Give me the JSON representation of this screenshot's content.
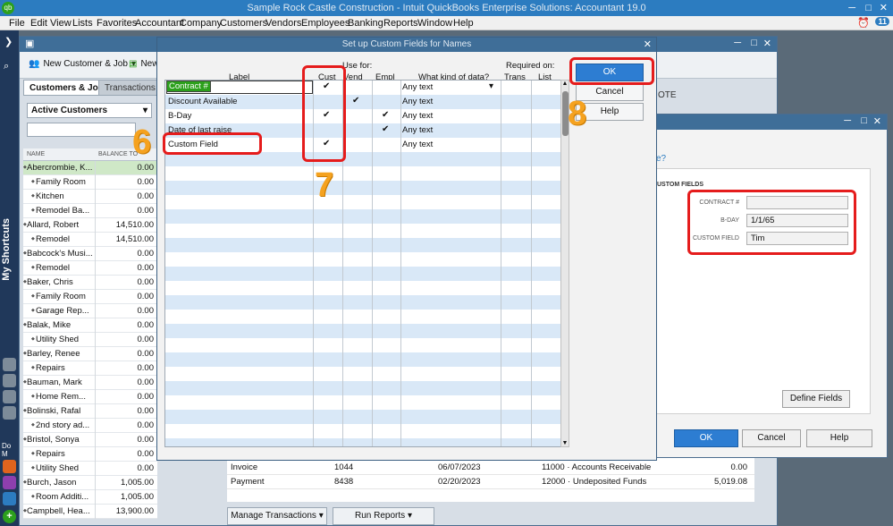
{
  "app": {
    "title": "Sample Rock Castle Construction  - Intuit QuickBooks Enterprise Solutions: Accountant 19.0",
    "logo": "qb",
    "notif_count": "11"
  },
  "menu": [
    "File",
    "Edit",
    "View",
    "Lists",
    "Favorites",
    "Accountant",
    "Company",
    "Customers",
    "Vendors",
    "Employees",
    "Banking",
    "Reports",
    "Window",
    "Help"
  ],
  "shortcuts_label": "My Shortcuts",
  "do_more_label": "Do M",
  "toolbar": {
    "new_customer_job": "New Customer & Job",
    "new_trans": "New"
  },
  "tabs": {
    "customers_jobs": "Customers & Jobs",
    "transactions": "Transactions"
  },
  "filter": {
    "value": "Active Customers"
  },
  "list_headers": {
    "name": "NAME",
    "balance": "BALANCE TO"
  },
  "customers": [
    {
      "name": "Abercrombie, K...",
      "balance": "0.00",
      "indent": 0,
      "selected": true
    },
    {
      "name": "Family Room",
      "balance": "0.00",
      "indent": 1
    },
    {
      "name": "Kitchen",
      "balance": "0.00",
      "indent": 1
    },
    {
      "name": "Remodel Ba...",
      "balance": "0.00",
      "indent": 1
    },
    {
      "name": "Allard, Robert",
      "balance": "14,510.00",
      "indent": 0
    },
    {
      "name": "Remodel",
      "balance": "14,510.00",
      "indent": 1
    },
    {
      "name": "Babcock's Musi...",
      "balance": "0.00",
      "indent": 0
    },
    {
      "name": "Remodel",
      "balance": "0.00",
      "indent": 1
    },
    {
      "name": "Baker, Chris",
      "balance": "0.00",
      "indent": 0
    },
    {
      "name": "Family Room",
      "balance": "0.00",
      "indent": 1
    },
    {
      "name": "Garage Rep...",
      "balance": "0.00",
      "indent": 1
    },
    {
      "name": "Balak, Mike",
      "balance": "0.00",
      "indent": 0
    },
    {
      "name": "Utility Shed",
      "balance": "0.00",
      "indent": 1
    },
    {
      "name": "Barley, Renee",
      "balance": "0.00",
      "indent": 0
    },
    {
      "name": "Repairs",
      "balance": "0.00",
      "indent": 1
    },
    {
      "name": "Bauman, Mark",
      "balance": "0.00",
      "indent": 0
    },
    {
      "name": "Home Rem...",
      "balance": "0.00",
      "indent": 1
    },
    {
      "name": "Bolinski, Rafal",
      "balance": "0.00",
      "indent": 0
    },
    {
      "name": "2nd story ad...",
      "balance": "0.00",
      "indent": 1
    },
    {
      "name": "Bristol, Sonya",
      "balance": "0.00",
      "indent": 0
    },
    {
      "name": "Repairs",
      "balance": "0.00",
      "indent": 1
    },
    {
      "name": "Utility Shed",
      "balance": "0.00",
      "indent": 1
    },
    {
      "name": "Burch, Jason",
      "balance": "1,005.00",
      "indent": 0
    },
    {
      "name": "Room Additi...",
      "balance": "1,005.00",
      "indent": 1
    },
    {
      "name": "Campbell, Hea...",
      "balance": "13,900.00",
      "indent": 0
    }
  ],
  "note_fragment": "OTE",
  "transactions": [
    {
      "type": "Invoice",
      "num": "1044",
      "date": "06/07/2023",
      "account": "11000 · Accounts Receivable",
      "amount": "0.00"
    },
    {
      "type": "Payment",
      "num": "8438",
      "date": "02/20/2023",
      "account": "12000 · Undeposited Funds",
      "amount": "5,019.08"
    }
  ],
  "bottom_buttons": {
    "manage": "Manage Transactions",
    "reports": "Run Reports"
  },
  "edit_dialog": {
    "question_fragment": "e?",
    "section_title": "USTOM FIELDS",
    "fields": [
      {
        "label": "CONTRACT #",
        "value": ""
      },
      {
        "label": "B-DAY",
        "value": "1/1/65"
      },
      {
        "label": "CUSTOM FIELD",
        "value": "Tim"
      }
    ],
    "define_fields": "Define Fields",
    "ok": "OK",
    "cancel": "Cancel",
    "help": "Help"
  },
  "setup_dialog": {
    "title": "Set up Custom Fields for Names",
    "headers": {
      "label": "Label",
      "use_for": "Use for:",
      "cust": "Cust",
      "vend": "Vend",
      "empl": "Empl",
      "kind": "What kind of data?",
      "required": "Required on:",
      "trans": "Trans",
      "list": "List"
    },
    "rows": [
      {
        "label": "Contract #",
        "cust": "✔",
        "vend": "",
        "empl": "",
        "kind": "Any text",
        "active": true
      },
      {
        "label": "Discount Available",
        "cust": "",
        "vend": "✔",
        "empl": "",
        "kind": "Any text"
      },
      {
        "label": "B-Day",
        "cust": "✔",
        "vend": "",
        "empl": "✔",
        "kind": "Any text"
      },
      {
        "label": "Date of last raise",
        "cust": "",
        "vend": "",
        "empl": "✔",
        "kind": "Any text"
      },
      {
        "label": "Custom Field",
        "cust": "✔",
        "vend": "",
        "empl": "",
        "kind": "Any text"
      }
    ],
    "buttons": {
      "ok": "OK",
      "cancel": "Cancel",
      "help": "Help"
    }
  },
  "annotations": {
    "six": "6",
    "seven": "7",
    "eight": "8"
  },
  "colors": {
    "accent": "#2d7dd2",
    "annotation_red": "#e51c1c",
    "callout_orange": "#f5a21f",
    "selected_row": "#cfe8c7",
    "alt_row": "#d9e8f7"
  }
}
